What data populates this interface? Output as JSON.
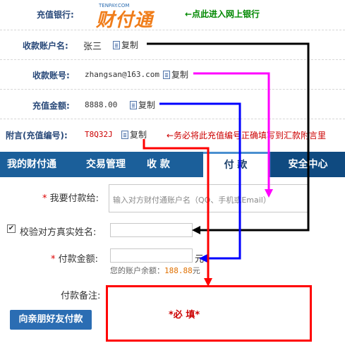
{
  "rows": {
    "bank": {
      "label": "充值银行:",
      "logo_small": "TENPAY.COM",
      "logo": "财付通",
      "note": "←点此进入网上银行"
    },
    "name": {
      "label": "收款账户名:",
      "value": "张三",
      "copy": "复制"
    },
    "account": {
      "label": "收款账号:",
      "value": "zhangsan@163.com",
      "copy": "复制"
    },
    "amount": {
      "label": "充值金额:",
      "value": "8888.00",
      "copy": "复制"
    },
    "memo": {
      "label": "附言(充值编号):",
      "value": "T8Q32J",
      "copy": "复制",
      "note": "←务必将此充值编号正确填写到汇款附言里"
    }
  },
  "tabs": [
    "我的财付通",
    "交易管理",
    "收 款",
    "付 款",
    "安全中心"
  ],
  "form": {
    "payto_label": "我要付款给:",
    "payto_placeholder": "输入对方财付通账户名（QQ、手机或Email）",
    "verify_label": "校验对方真实姓名:",
    "verify_checked": true,
    "amount_label": "付款金额:",
    "amount_unit": "元",
    "balance_text": "您的账户余额：",
    "balance_value": "188.88",
    "balance_unit": "元",
    "remark_label": "付款备注:",
    "required_text": "*必 填*",
    "submit": "向亲朋好友付款",
    "required_mark": "*"
  },
  "colors": {
    "arrow_black": "#000000",
    "arrow_magenta": "#ff00ff",
    "arrow_blue": "#0000ff",
    "arrow_red": "#ff0000",
    "note_green": "#008800",
    "note_red": "#cc0000",
    "tab_bar": "#1b5f9a"
  }
}
